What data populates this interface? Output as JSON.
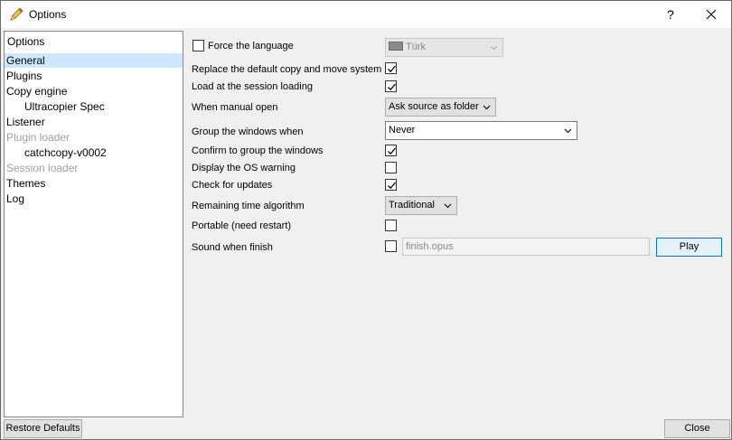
{
  "window": {
    "title": "Options",
    "help_label": "?"
  },
  "tree": {
    "header": "Options",
    "items": [
      {
        "label": "General",
        "level": 0,
        "selected": true,
        "enabled": true
      },
      {
        "label": "Plugins",
        "level": 0,
        "selected": false,
        "enabled": true
      },
      {
        "label": "Copy engine",
        "level": 0,
        "selected": false,
        "enabled": true
      },
      {
        "label": "Ultracopier Spec",
        "level": 1,
        "selected": false,
        "enabled": true
      },
      {
        "label": "Listener",
        "level": 0,
        "selected": false,
        "enabled": true
      },
      {
        "label": "Plugin loader",
        "level": 0,
        "selected": false,
        "enabled": false
      },
      {
        "label": "catchcopy-v0002",
        "level": 1,
        "selected": false,
        "enabled": true
      },
      {
        "label": "Session loader",
        "level": 0,
        "selected": false,
        "enabled": false
      },
      {
        "label": "Themes",
        "level": 0,
        "selected": false,
        "enabled": true
      },
      {
        "label": "Log",
        "level": 0,
        "selected": false,
        "enabled": true
      }
    ]
  },
  "general": {
    "force_language": {
      "label": "Force the language",
      "checked": false,
      "value": "Türk"
    },
    "replace_default": {
      "label": "Replace the default copy and move system",
      "checked": true
    },
    "load_session": {
      "label": "Load at the session loading",
      "checked": true
    },
    "manual_open": {
      "label": "When manual open",
      "value": "Ask source as folder"
    },
    "group_windows": {
      "label": "Group the windows when",
      "value": "Never"
    },
    "confirm_group": {
      "label": "Confirm to group the windows",
      "checked": true
    },
    "os_warning": {
      "label": "Display the OS warning",
      "checked": false
    },
    "check_updates": {
      "label": "Check for updates",
      "checked": true
    },
    "remaining_time": {
      "label": "Remaining time algorithm",
      "value": "Traditional"
    },
    "portable": {
      "label": "Portable (need restart)",
      "checked": false
    },
    "sound_finish": {
      "label": "Sound when finish",
      "checked": false,
      "file": "finish.opus",
      "play_label": "Play"
    }
  },
  "footer": {
    "restore_label": "Restore Defaults",
    "close_label": "Close"
  }
}
